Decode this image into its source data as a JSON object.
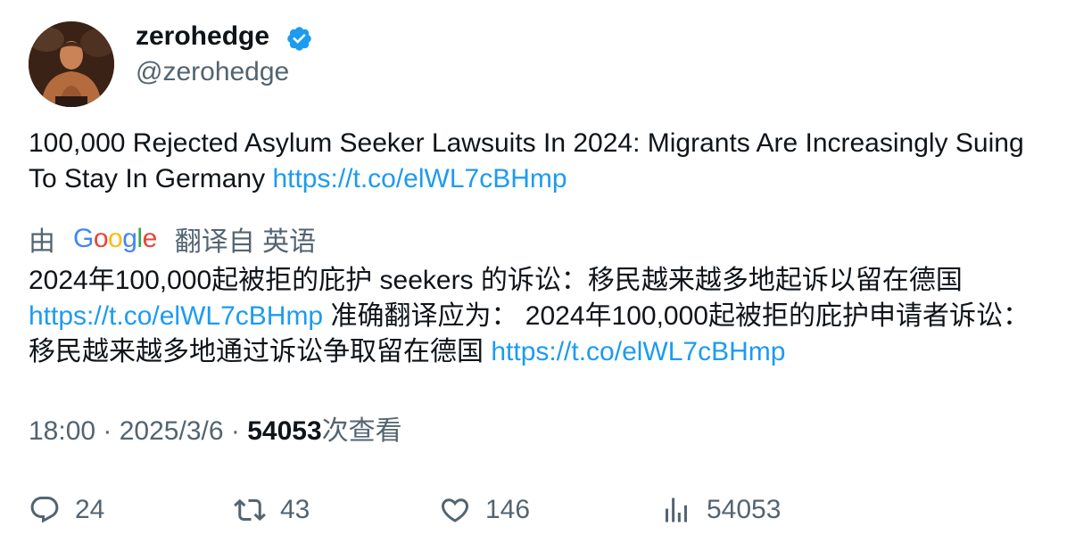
{
  "author": {
    "display_name": "zerohedge",
    "handle": "@zerohedge",
    "verified": true,
    "verified_color": "#1d9bf0"
  },
  "tweet": {
    "text": "100,000 Rejected Asylum Seeker Lawsuits In 2024: Migrants Are Increasingly Suing To Stay In Germany",
    "link": "https://t.co/elWL7cBHmp"
  },
  "translation": {
    "prefix": "由",
    "provider_letters": [
      "G",
      "o",
      "o",
      "g",
      "l",
      "e"
    ],
    "suffix": "翻译自 英语",
    "part1": "2024年100,000起被拒的庇护 seekers 的诉讼：移民越来越多地起诉以留在德国",
    "link1": "https://t.co/elWL7cBHmp",
    "part2": " 准确翻译应为： 2024年100,000起被拒的庇护申请者诉讼：移民越来越多地通过诉讼争取留在德国",
    "link2": "https://t.co/elWL7cBHmp"
  },
  "meta": {
    "time": "18:00",
    "sep1": " · ",
    "date": "2025/3/6",
    "sep2": " · ",
    "views_count": "54053",
    "views_label": "次查看"
  },
  "actions": {
    "replies": "24",
    "retweets": "43",
    "likes": "146",
    "views": "54053"
  },
  "colors": {
    "text": "#0f1419",
    "secondary": "#536471",
    "link": "#1d9bf0"
  }
}
